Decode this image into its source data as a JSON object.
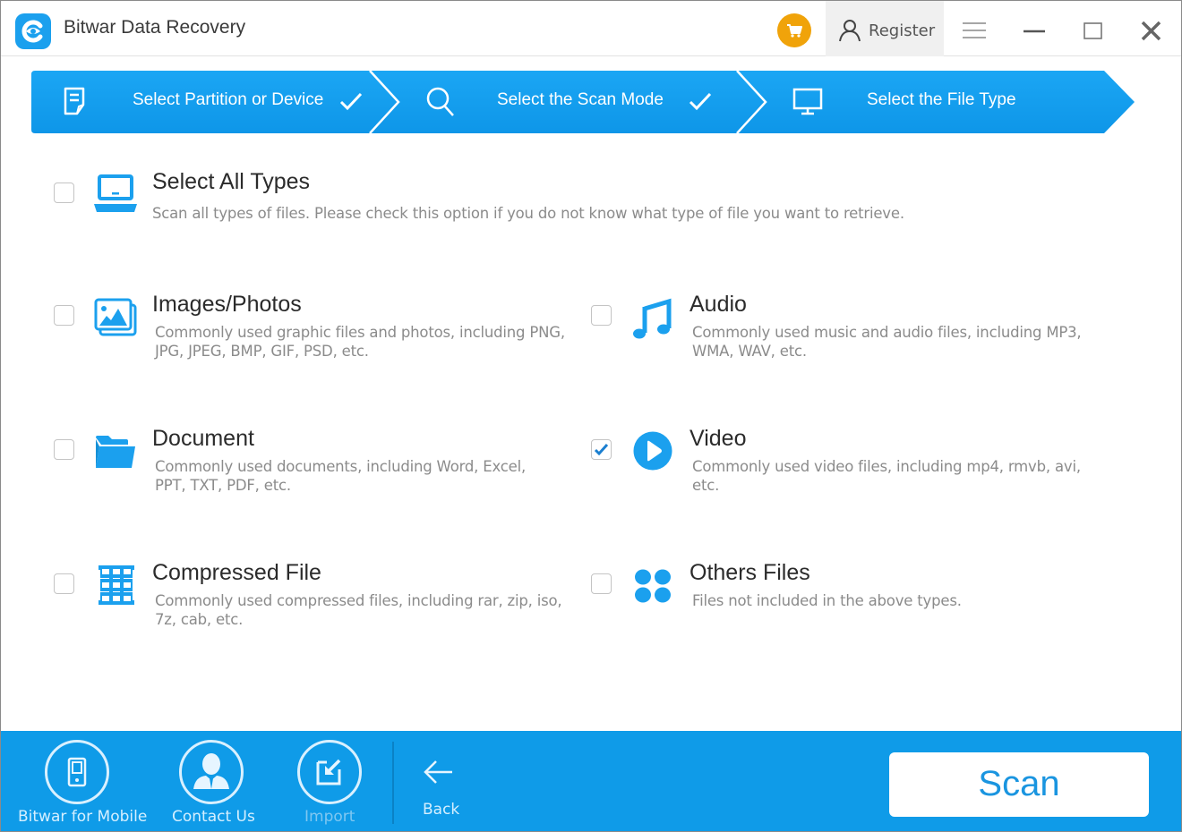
{
  "app": {
    "title": "Bitwar Data Recovery",
    "accent_color": "#1ba0ee",
    "cart_color": "#f0a30a"
  },
  "titlebar": {
    "register_label": "Register",
    "icons": [
      "cart-icon",
      "user-icon",
      "menu-icon",
      "minimize-icon",
      "maximize-icon",
      "close-icon"
    ]
  },
  "steps": [
    {
      "label": "Select Partition or Device",
      "icon": "document-icon",
      "completed": true
    },
    {
      "label": "Select the Scan Mode",
      "icon": "search-icon",
      "completed": true
    },
    {
      "label": "Select the File Type",
      "icon": "monitor-icon",
      "completed": false
    }
  ],
  "select_all": {
    "title": "Select All Types",
    "description": "Scan all types of files. Please check this option if you do not know what type of file you want to retrieve.",
    "checked": false,
    "icon": "laptop-icon"
  },
  "file_types": [
    {
      "title": "Images/Photos",
      "description": "Commonly used graphic files and photos, including PNG, JPG, JPEG, BMP, GIF, PSD, etc.",
      "checked": false,
      "icon": "image-icon"
    },
    {
      "title": "Audio",
      "description": "Commonly used music and audio files, including MP3, WMA, WAV, etc.",
      "checked": false,
      "icon": "music-note-icon"
    },
    {
      "title": "Document",
      "description": "Commonly used documents, including Word, Excel, PPT, TXT, PDF, etc.",
      "checked": false,
      "icon": "folder-icon"
    },
    {
      "title": "Video",
      "description": "Commonly used video files, including mp4, rmvb, avi, etc.",
      "checked": true,
      "icon": "play-icon"
    },
    {
      "title": "Compressed File",
      "description": "Commonly used compressed files, including rar, zip, iso, 7z, cab, etc.",
      "checked": false,
      "icon": "archive-icon"
    },
    {
      "title": "Others Files",
      "description": "Files not included in the above types.",
      "checked": false,
      "icon": "grid-dots-icon"
    }
  ],
  "bottombar": {
    "mobile_label": "Bitwar for Mobile",
    "contact_label": "Contact Us",
    "import_label": "Import",
    "back_label": "Back",
    "scan_label": "Scan"
  }
}
